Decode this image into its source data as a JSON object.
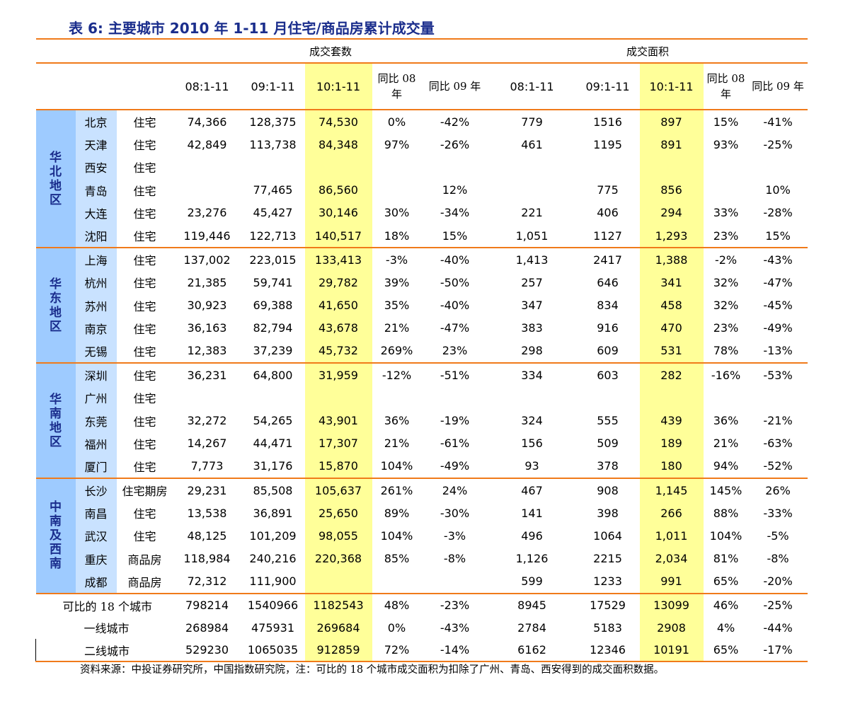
{
  "title": "表 6:  主要城市 2010 年 1-11 月住宅/商品房累计成交量",
  "headers": {
    "group_volume": "成交套数",
    "group_area": "成交面积",
    "v0811": "08:1-11",
    "v0911": "09:1-11",
    "v1011": "10:1-11",
    "yoy08": "同比 08 年",
    "yoy09": "同比 09 年",
    "a0811": "08:1-11",
    "a0911": "09:1-11",
    "a1011": "10:1-11",
    "ayoy08": "同比 08 年",
    "ayoy09": "同比 09 年"
  },
  "regions": {
    "r0": "华北地区",
    "r1": "华东地区",
    "r2": "华南地区",
    "r3": "中南及西南"
  },
  "rows": [
    [
      "北京",
      "住宅",
      "74,366",
      "128,375",
      "74,530",
      "0%",
      "-42%",
      "779",
      "1516",
      "897",
      "15%",
      "-41%"
    ],
    [
      "天津",
      "住宅",
      "42,849",
      "113,738",
      "84,348",
      "97%",
      "-26%",
      "461",
      "1195",
      "891",
      "93%",
      "-25%"
    ],
    [
      "西安",
      "住宅",
      "",
      "",
      "",
      "",
      "",
      "",
      "",
      "",
      "",
      ""
    ],
    [
      "青岛",
      "住宅",
      "",
      "77,465",
      "86,560",
      "",
      "12%",
      "",
      "775",
      "856",
      "",
      "10%"
    ],
    [
      "大连",
      "住宅",
      "23,276",
      "45,427",
      "30,146",
      "30%",
      "-34%",
      "221",
      "406",
      "294",
      "33%",
      "-28%"
    ],
    [
      "沈阳",
      "住宅",
      "119,446",
      "122,713",
      "140,517",
      "18%",
      "15%",
      "1,051",
      "1127",
      "1,293",
      "23%",
      "15%"
    ],
    [
      "上海",
      "住宅",
      "137,002",
      "223,015",
      "133,413",
      "-3%",
      "-40%",
      "1,413",
      "2417",
      "1,388",
      "-2%",
      "-43%"
    ],
    [
      "杭州",
      "住宅",
      "21,385",
      "59,741",
      "29,782",
      "39%",
      "-50%",
      "257",
      "646",
      "341",
      "32%",
      "-47%"
    ],
    [
      "苏州",
      "住宅",
      "30,923",
      "69,388",
      "41,650",
      "35%",
      "-40%",
      "347",
      "834",
      "458",
      "32%",
      "-45%"
    ],
    [
      "南京",
      "住宅",
      "36,163",
      "82,794",
      "43,678",
      "21%",
      "-47%",
      "383",
      "916",
      "470",
      "23%",
      "-49%"
    ],
    [
      "无锡",
      "住宅",
      "12,383",
      "37,239",
      "45,732",
      "269%",
      "23%",
      "298",
      "609",
      "531",
      "78%",
      "-13%"
    ],
    [
      "深圳",
      "住宅",
      "36,231",
      "64,800",
      "31,959",
      "-12%",
      "-51%",
      "334",
      "603",
      "282",
      "-16%",
      "-53%"
    ],
    [
      "广州",
      "住宅",
      "",
      "",
      "",
      "",
      "",
      "",
      "",
      "",
      "",
      ""
    ],
    [
      "东莞",
      "住宅",
      "32,272",
      "54,265",
      "43,901",
      "36%",
      "-19%",
      "324",
      "555",
      "439",
      "36%",
      "-21%"
    ],
    [
      "福州",
      "住宅",
      "14,267",
      "44,471",
      "17,307",
      "21%",
      "-61%",
      "156",
      "509",
      "189",
      "21%",
      "-63%"
    ],
    [
      "厦门",
      "住宅",
      "7,773",
      "31,176",
      "15,870",
      "104%",
      "-49%",
      "93",
      "378",
      "180",
      "94%",
      "-52%"
    ],
    [
      "长沙",
      "住宅期房",
      "29,231",
      "85,508",
      "105,637",
      "261%",
      "24%",
      "467",
      "908",
      "1,145",
      "145%",
      "26%"
    ],
    [
      "南昌",
      "住宅",
      "13,538",
      "36,891",
      "25,650",
      "89%",
      "-30%",
      "141",
      "398",
      "266",
      "88%",
      "-33%"
    ],
    [
      "武汉",
      "住宅",
      "48,125",
      "101,209",
      "98,055",
      "104%",
      "-3%",
      "496",
      "1064",
      "1,011",
      "104%",
      "-5%"
    ],
    [
      "重庆",
      "商品房",
      "118,984",
      "240,216",
      "220,368",
      "85%",
      "-8%",
      "1,126",
      "2215",
      "2,034",
      "81%",
      "-8%"
    ],
    [
      "成都",
      "商品房",
      "72,312",
      "111,900",
      "",
      "",
      "",
      "599",
      "1233",
      "991",
      "65%",
      "-20%"
    ]
  ],
  "summary": [
    [
      "可比的 18 个城市",
      "798214",
      "1540966",
      "1182543",
      "48%",
      "-23%",
      "8945",
      "17529",
      "13099",
      "46%",
      "-25%"
    ],
    [
      "一线城市",
      "268984",
      "475931",
      "269684",
      "0%",
      "-43%",
      "2784",
      "5183",
      "2908",
      "4%",
      "-44%"
    ],
    [
      "二线城市",
      "529230",
      "1065035",
      "912859",
      "72%",
      "-14%",
      "6162",
      "12346",
      "10191",
      "65%",
      "-17%"
    ]
  ],
  "note": "资料来源：中投证券研究所，中国指数研究院，注：可比的 18 个城市成交面积为扣除了广州、青岛、西安得到的成交面积数据。",
  "colors": {
    "title": "#1a2d8c",
    "rule": "#f07a1a",
    "highlight": "#ffff99",
    "region_bg": "#9ecbff",
    "city_bg": "#c9e2ff"
  }
}
